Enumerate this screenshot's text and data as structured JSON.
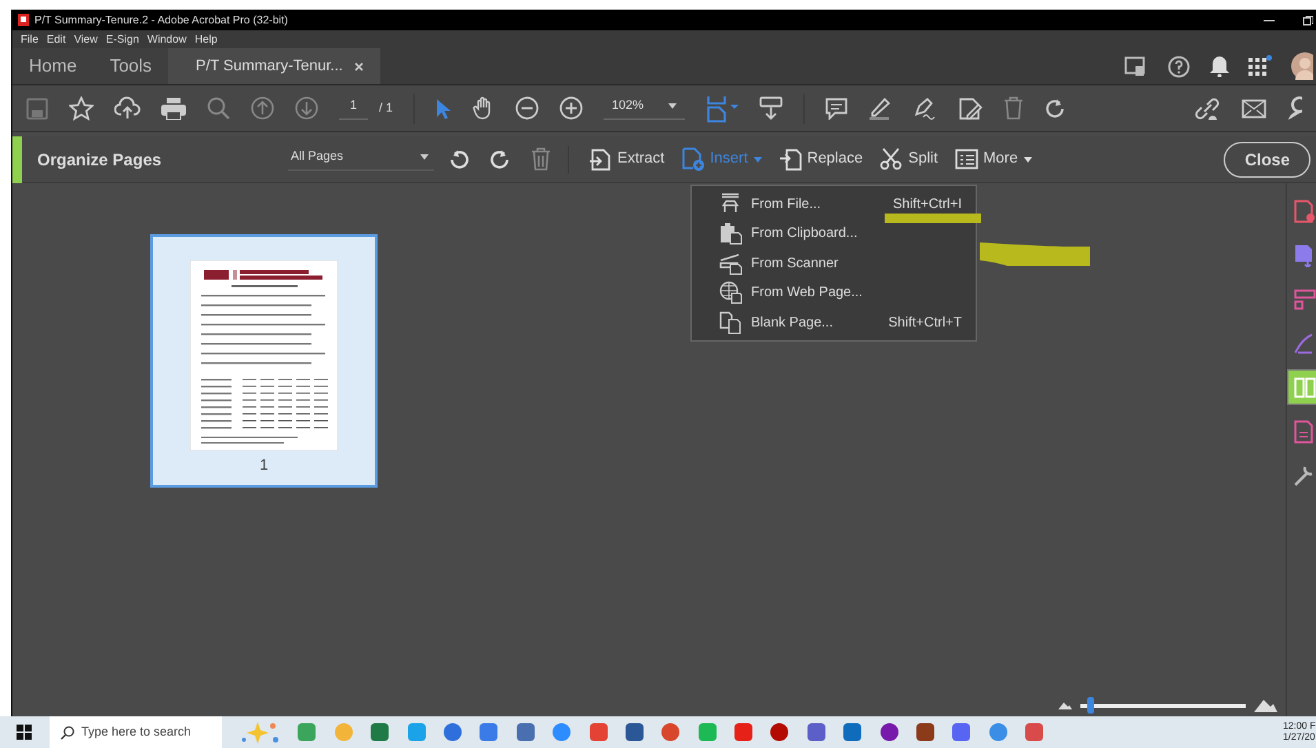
{
  "window": {
    "title": "P/T Summary-Tenure.2 - Adobe Acrobat Pro (32-bit)"
  },
  "menu": [
    "File",
    "Edit",
    "View",
    "E-Sign",
    "Window",
    "Help"
  ],
  "tabs": [
    {
      "label": "Home",
      "selected": false,
      "closable": false
    },
    {
      "label": "Tools",
      "selected": false,
      "closable": false
    },
    {
      "label": "P/T Summary-Tenur...",
      "selected": true,
      "closable": true
    }
  ],
  "toolbar": {
    "page_number": "1",
    "page_total": "/ 1",
    "zoom": "102%",
    "tools": [
      {
        "kind": "select",
        "selected": true
      },
      {
        "kind": "hand",
        "selected": false
      }
    ]
  },
  "organize": {
    "title": "Organize Pages",
    "range": "All Pages",
    "actions": [
      {
        "label": "Extract",
        "kind": "extract",
        "open": false,
        "has_menu": false
      },
      {
        "label": "Insert",
        "kind": "insert",
        "open": true,
        "has_menu": true
      },
      {
        "label": "Replace",
        "kind": "replace",
        "open": false,
        "has_menu": false
      },
      {
        "label": "Split",
        "kind": "split",
        "open": false,
        "has_menu": false
      },
      {
        "label": "More",
        "kind": "more",
        "open": false,
        "has_menu": true
      }
    ],
    "close": "Close"
  },
  "insert_menu": [
    {
      "label": "From File...",
      "shortcut": "Shift+Ctrl+I",
      "kind": "file"
    },
    {
      "label": "From Clipboard...",
      "kind": "clipboard"
    },
    {
      "label": "From Scanner",
      "kind": "scanner"
    },
    {
      "label": "From Web Page...",
      "kind": "web"
    },
    {
      "label": "Blank Page...",
      "shortcut": "Shift+Ctrl+T",
      "kind": "blank"
    }
  ],
  "pages": [
    {
      "number": "1",
      "selected": true
    }
  ],
  "zoom_slider": {
    "level": 0.04
  },
  "right_panel": [
    {
      "color": "#e8566c",
      "selected": false
    },
    {
      "color": "#8c7bea",
      "selected": false
    },
    {
      "color": "#e0559c",
      "selected": false
    },
    {
      "color": "#9b6be0",
      "selected": false
    },
    {
      "color": "#8fd14f",
      "selected": true
    },
    {
      "color": "#e0559c",
      "selected": false
    },
    {
      "color": "#b9b9b9",
      "selected": false
    }
  ],
  "taskbar": {
    "search_placeholder": "Type here to search",
    "time": "12:00 F",
    "date": "1/27/20",
    "apps": [
      {
        "color": "#3ba55c"
      },
      {
        "color": "#f2b53a"
      },
      {
        "color": "#1f7a45"
      },
      {
        "color": "#1aa3e8"
      },
      {
        "color": "#2f6fdc"
      },
      {
        "color": "#3b7be8"
      },
      {
        "color": "#4a6fb0"
      },
      {
        "color": "#2d8cff"
      },
      {
        "color": "#e34234"
      },
      {
        "color": "#2b5797"
      },
      {
        "color": "#d8462b"
      },
      {
        "color": "#1db954"
      },
      {
        "color": "#e62117"
      },
      {
        "color": "#b30b00"
      },
      {
        "color": "#5b5fc7"
      },
      {
        "color": "#0f6cbd"
      },
      {
        "color": "#7719aa"
      },
      {
        "color": "#8b3a1a"
      },
      {
        "color": "#5865f2"
      },
      {
        "color": "#3a8ee6"
      },
      {
        "color": "#d94a4a"
      }
    ]
  }
}
